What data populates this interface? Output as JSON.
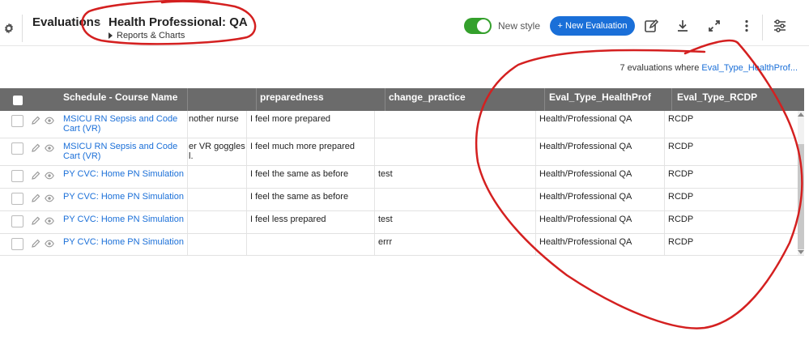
{
  "header": {
    "breadcrumb_root": "Evaluations",
    "breadcrumb_chevron": "›",
    "title": "Health Professional: QA",
    "subtitle": "Reports & Charts",
    "toggle_label": "New style",
    "toggle_on": true,
    "new_button": "+ New Evaluation",
    "icons": [
      "gear-icon",
      "edit-icon",
      "download-icon",
      "expand-icon",
      "more-vert-icon",
      "sliders-icon"
    ]
  },
  "summary": {
    "prefix": "7 evaluations where ",
    "filter_link": "Eval_Type_HealthProf..."
  },
  "table": {
    "columns": [
      "Schedule - Course Name",
      "",
      "preparedness",
      "change_practice",
      "Eval_Type_HealthProf",
      "Eval_Type_RCDP"
    ],
    "rows": [
      {
        "course": "MSICU RN Sepsis and Code Cart (VR)",
        "partial": "nother nurse",
        "partial2": "",
        "preparedness": "I feel more prepared",
        "change_practice": "",
        "healthprof": "Health/Professional QA",
        "rcdp": "RCDP"
      },
      {
        "course": "MSICU RN Sepsis and Code Cart (VR)",
        "partial": "er VR goggles",
        "partial2": "l.",
        "preparedness": "I feel much more prepared",
        "change_practice": "",
        "healthprof": "Health/Professional QA",
        "rcdp": "RCDP"
      },
      {
        "course": "PY CVC: Home PN Simulation",
        "partial": "",
        "partial2": "",
        "preparedness": "I feel the same as before",
        "change_practice": "test",
        "healthprof": "Health/Professional QA",
        "rcdp": "RCDP"
      },
      {
        "course": "PY CVC: Home PN Simulation",
        "partial": "",
        "partial2": "",
        "preparedness": "I feel the same as before",
        "change_practice": "",
        "healthprof": "Health/Professional QA",
        "rcdp": "RCDP"
      },
      {
        "course": "PY CVC: Home PN Simulation",
        "partial": "",
        "partial2": "",
        "preparedness": "I feel less prepared",
        "change_practice": "test",
        "healthprof": "Health/Professional QA",
        "rcdp": "RCDP"
      },
      {
        "course": "PY CVC: Home PN Simulation",
        "partial": "",
        "partial2": "",
        "preparedness": "",
        "change_practice": "errr",
        "healthprof": "Health/Professional QA",
        "rcdp": "RCDP"
      }
    ]
  },
  "colors": {
    "accent": "#1a6fd8",
    "toggle": "#34a02c",
    "header_bg": "#6b6b6b",
    "annotation": "#d42020"
  }
}
